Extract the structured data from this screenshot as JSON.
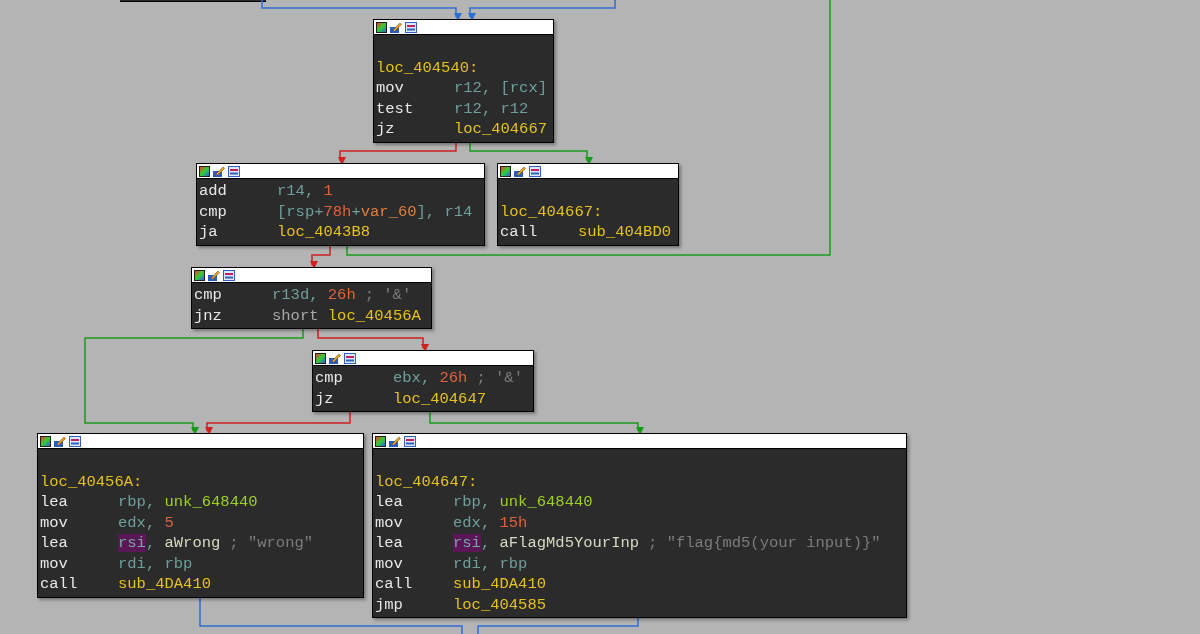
{
  "graph": {
    "nodes": [
      {
        "header_gap": true,
        "lines": [
          {
            "kind": "label",
            "text": "loc_404540:"
          },
          {
            "kind": "insn",
            "mnemonic": "mov",
            "operands": [
              {
                "text": "r12, [rcx]",
                "kind": "reg"
              }
            ]
          },
          {
            "kind": "insn",
            "mnemonic": "test",
            "operands": [
              {
                "text": "r12, r12",
                "kind": "reg"
              }
            ]
          },
          {
            "kind": "insn",
            "mnemonic": "jz",
            "operands": [
              {
                "text": "loc_404667",
                "kind": "code_name"
              }
            ]
          }
        ]
      },
      {
        "header_gap": false,
        "lines": [
          {
            "kind": "insn",
            "mnemonic": "add",
            "operands": [
              {
                "text": "r14, ",
                "kind": "reg"
              },
              {
                "text": "1",
                "kind": "number"
              }
            ]
          },
          {
            "kind": "insn",
            "mnemonic": "cmp",
            "operands": [
              {
                "text": "[rsp+",
                "kind": "reg"
              },
              {
                "text": "78h",
                "kind": "number"
              },
              {
                "text": "+",
                "kind": "reg"
              },
              {
                "text": "var_60",
                "kind": "stack_var"
              },
              {
                "text": "], r14",
                "kind": "reg"
              }
            ]
          },
          {
            "kind": "insn",
            "mnemonic": "ja",
            "operands": [
              {
                "text": "loc_4043B8",
                "kind": "code_name"
              }
            ]
          }
        ]
      },
      {
        "header_gap": true,
        "lines": [
          {
            "kind": "label",
            "text": "loc_404667:"
          },
          {
            "kind": "insn",
            "mnemonic": "call",
            "operands": [
              {
                "text": "sub_404BD0",
                "kind": "code_name"
              }
            ]
          }
        ]
      },
      {
        "header_gap": false,
        "lines": [
          {
            "kind": "insn",
            "mnemonic": "cmp",
            "operands": [
              {
                "text": "r13d, ",
                "kind": "reg"
              },
              {
                "text": "26h",
                "kind": "number"
              }
            ],
            "comment": "; '&'"
          },
          {
            "kind": "insn",
            "mnemonic": "jnz",
            "operands": [
              {
                "text": "short ",
                "kind": "keyword"
              },
              {
                "text": "loc_40456A",
                "kind": "code_name"
              }
            ]
          }
        ]
      },
      {
        "header_gap": false,
        "lines": [
          {
            "kind": "insn",
            "mnemonic": "cmp",
            "operands": [
              {
                "text": "ebx, ",
                "kind": "reg"
              },
              {
                "text": "26h",
                "kind": "number"
              }
            ],
            "comment": "; '&'"
          },
          {
            "kind": "insn",
            "mnemonic": "jz",
            "operands": [
              {
                "text": "loc_404647",
                "kind": "code_name"
              }
            ]
          }
        ]
      },
      {
        "header_gap": true,
        "lines": [
          {
            "kind": "label",
            "text": "loc_40456A:"
          },
          {
            "kind": "insn",
            "mnemonic": "lea",
            "operands": [
              {
                "text": "rbp, ",
                "kind": "reg"
              },
              {
                "text": "unk_648440",
                "kind": "data_name"
              }
            ]
          },
          {
            "kind": "insn",
            "mnemonic": "mov",
            "operands": [
              {
                "text": "edx, ",
                "kind": "reg"
              },
              {
                "text": "5",
                "kind": "number"
              }
            ]
          },
          {
            "kind": "insn",
            "mnemonic": "lea",
            "operands": [
              {
                "text": "rsi",
                "kind": "highlight"
              },
              {
                "text": ", ",
                "kind": "reg"
              },
              {
                "text": "aWrong",
                "kind": "string_name"
              }
            ],
            "comment": "; \"wrong\""
          },
          {
            "kind": "insn",
            "mnemonic": "mov",
            "operands": [
              {
                "text": "rdi, rbp",
                "kind": "reg"
              }
            ]
          },
          {
            "kind": "insn",
            "mnemonic": "call",
            "operands": [
              {
                "text": "sub_4DA410",
                "kind": "code_name"
              }
            ]
          }
        ]
      },
      {
        "header_gap": true,
        "lines": [
          {
            "kind": "label",
            "text": "loc_404647:"
          },
          {
            "kind": "insn",
            "mnemonic": "lea",
            "operands": [
              {
                "text": "rbp, ",
                "kind": "reg"
              },
              {
                "text": "unk_648440",
                "kind": "data_name"
              }
            ]
          },
          {
            "kind": "insn",
            "mnemonic": "mov",
            "operands": [
              {
                "text": "edx, ",
                "kind": "reg"
              },
              {
                "text": "15h",
                "kind": "number"
              }
            ]
          },
          {
            "kind": "insn",
            "mnemonic": "lea",
            "operands": [
              {
                "text": "rsi",
                "kind": "highlight"
              },
              {
                "text": ", ",
                "kind": "reg"
              },
              {
                "text": "aFlagMd5YourInp",
                "kind": "string_name"
              }
            ],
            "comment": "; \"flag{md5(your input)}\""
          },
          {
            "kind": "insn",
            "mnemonic": "mov",
            "operands": [
              {
                "text": "rdi, rbp",
                "kind": "reg"
              }
            ]
          },
          {
            "kind": "insn",
            "mnemonic": "call",
            "operands": [
              {
                "text": "sub_4DA410",
                "kind": "code_name"
              }
            ]
          },
          {
            "kind": "insn",
            "mnemonic": "jmp",
            "operands": [
              {
                "text": "loc_404585",
                "kind": "code_name"
              }
            ]
          }
        ]
      }
    ]
  }
}
